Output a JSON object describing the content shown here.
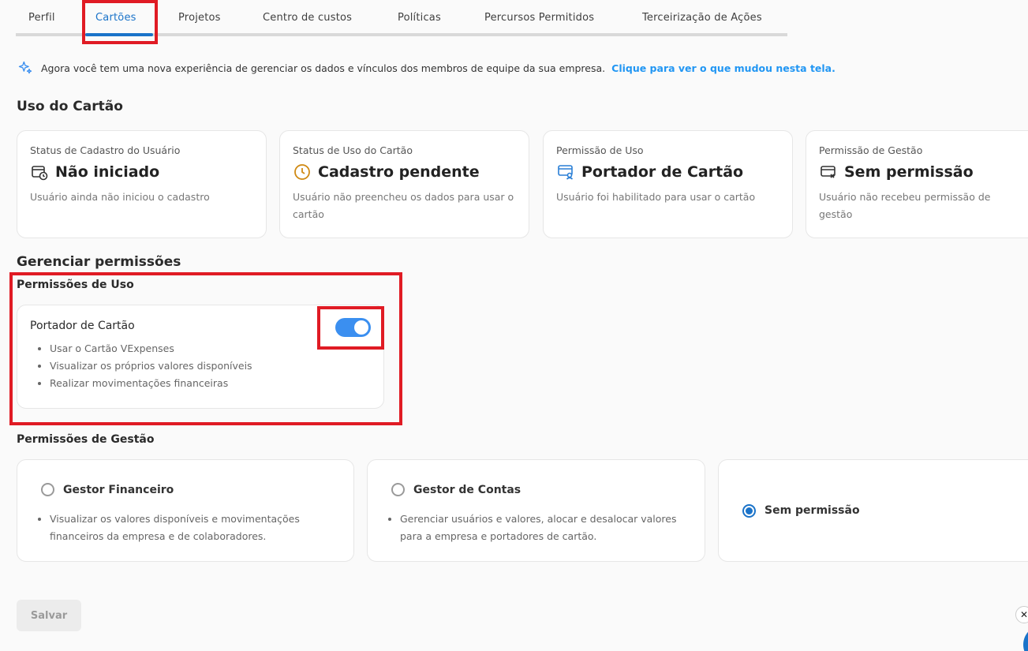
{
  "tabs": [
    {
      "label": "Perfil"
    },
    {
      "label": "Cartões"
    },
    {
      "label": "Projetos"
    },
    {
      "label": "Centro de custos"
    },
    {
      "label": "Políticas"
    },
    {
      "label": "Percursos Permitidos"
    },
    {
      "label": "Terceirização de Ações"
    }
  ],
  "active_tab": "Cartões",
  "banner": {
    "text": "Agora você tem uma nova experiência de gerenciar os dados e vínculos dos membros de equipe da sua empresa.",
    "link": "Clique para ver o que mudou nesta tela."
  },
  "usage": {
    "title": "Uso do Cartão",
    "cards": [
      {
        "label": "Status de Cadastro do Usuário",
        "value": "Não iniciado",
        "desc": "Usuário ainda não iniciou o cadastro",
        "icon": "calendar-clock-icon"
      },
      {
        "label": "Status de Uso do Cartão",
        "value": "Cadastro pendente",
        "desc": "Usuário não preencheu os dados para usar o cartão",
        "icon": "clock-icon"
      },
      {
        "label": "Permissão de Uso",
        "value": "Portador de Cartão",
        "desc": "Usuário foi habilitado para usar o cartão",
        "icon": "card-user-icon"
      },
      {
        "label": "Permissão de Gestão",
        "value": "Sem permissão",
        "desc": "Usuário não recebeu permissão de gestão",
        "icon": "card-x-icon"
      }
    ]
  },
  "manage": {
    "title": "Gerenciar permissões",
    "use_title": "Permissões de Uso",
    "use_card": {
      "title": "Portador de Cartão",
      "enabled": true,
      "items": [
        "Usar o Cartão VExpenses",
        "Visualizar os próprios valores disponíveis",
        "Realizar movimentações financeiras"
      ]
    },
    "mgmt_title": "Permissões de Gestão",
    "options": [
      {
        "label": "Gestor Financeiro",
        "checked": false,
        "desc": "Visualizar os valores disponíveis e movimentações financeiros da empresa e de colaboradores."
      },
      {
        "label": "Gestor de Contas",
        "checked": false,
        "desc": "Gerenciar usuários e valores, alocar e desalocar valores para a empresa e portadores de cartão."
      },
      {
        "label": "Sem permissão",
        "checked": true,
        "desc": ""
      }
    ]
  },
  "save_label": "Salvar",
  "close_label": "✕",
  "colors": {
    "accent": "#1a73c9",
    "highlight": "#e01b24",
    "toggle": "#3b8ff0",
    "link": "#2196f3"
  }
}
